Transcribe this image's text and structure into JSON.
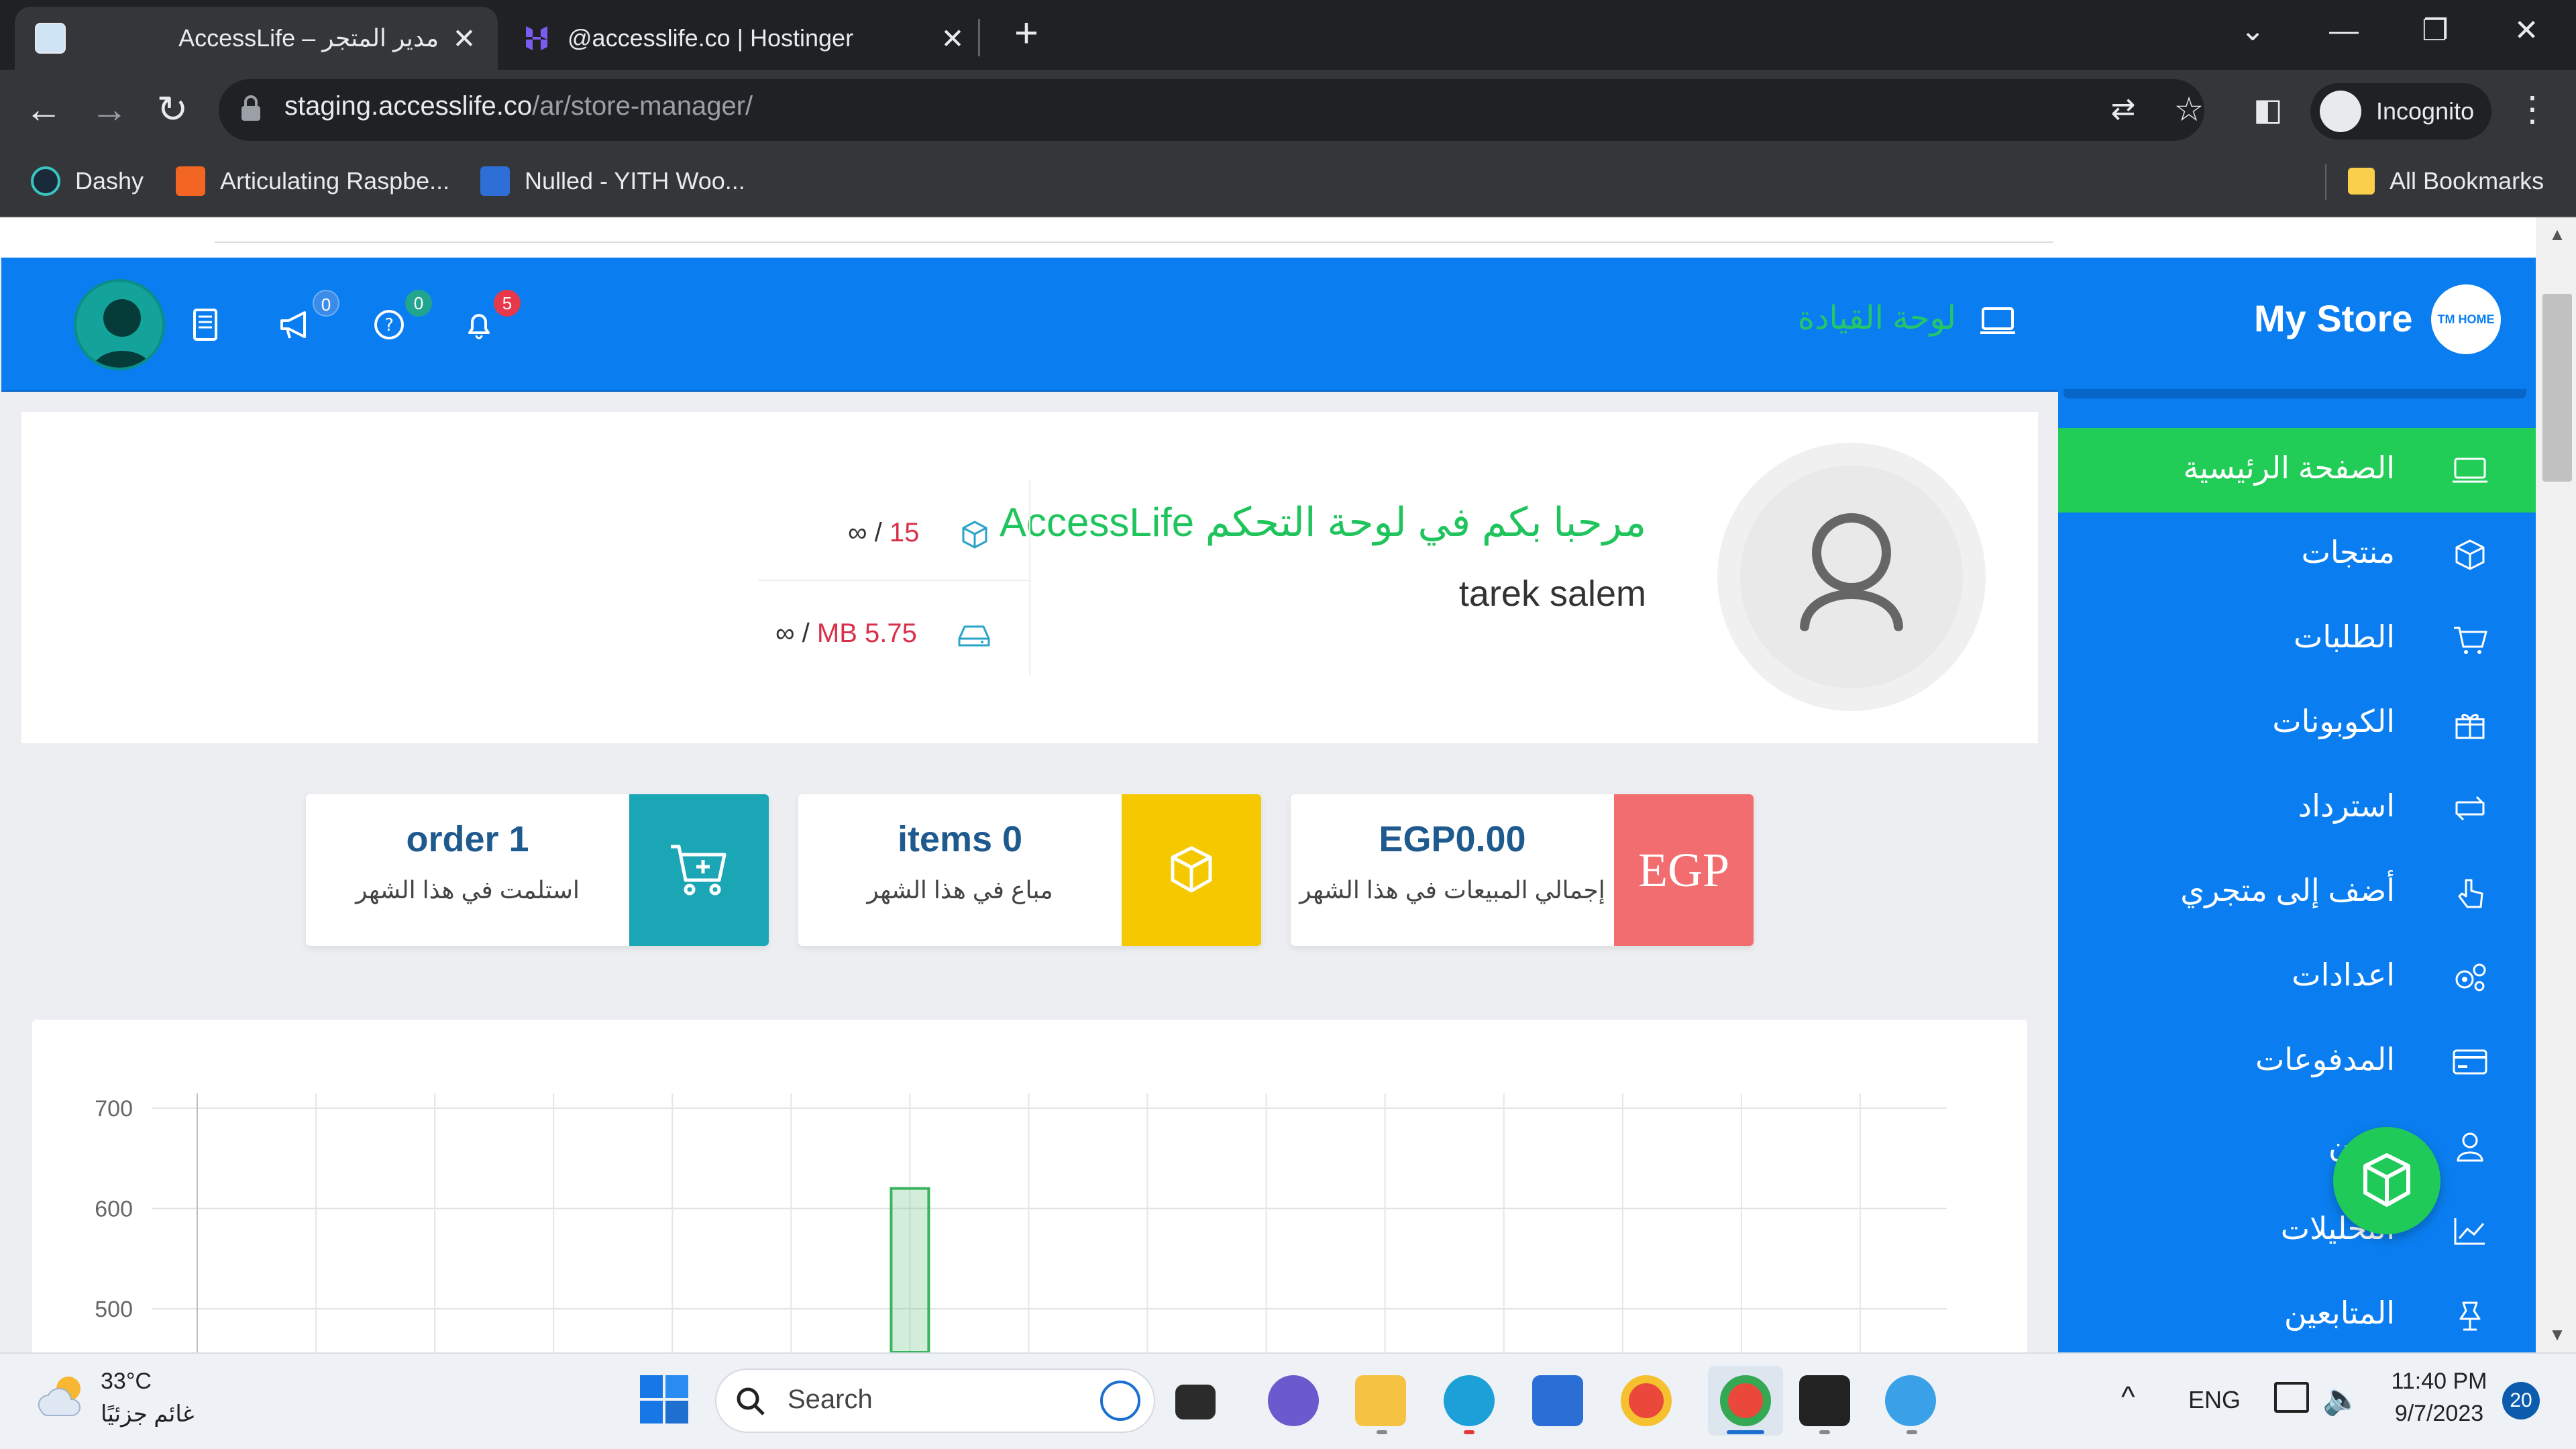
{
  "browser": {
    "tabs": [
      {
        "title": "AccessLife – مدير المتجر",
        "close": "✕"
      },
      {
        "title": "@accesslife.co | Hostinger",
        "close": "✕"
      }
    ],
    "new_tab": "+",
    "url_host": "staging.accesslife.co",
    "url_path": "/ar/store-manager/",
    "incognito_label": "Incognito",
    "bookmarks": [
      "Dashy",
      "Articulating Raspbe...",
      "Nulled - YITH Woo..."
    ],
    "all_bookmarks": "All Bookmarks"
  },
  "header": {
    "brand": "My Store",
    "brand_logo_text": "TM HOME",
    "dashboard_title": "لوحة القيادة",
    "badges": {
      "announcements": "0",
      "help": "0",
      "notifications": "5"
    }
  },
  "sidebar": {
    "items": [
      {
        "label": "الصفحة الرئيسية",
        "icon": "dashboard-icon",
        "active": true
      },
      {
        "label": "منتجات",
        "icon": "cube-icon"
      },
      {
        "label": "الطلبات",
        "icon": "cart-icon"
      },
      {
        "label": "الكوبونات",
        "icon": "gift-icon"
      },
      {
        "label": "استرداد",
        "icon": "refund-icon"
      },
      {
        "label": "أضف إلى متجري",
        "icon": "hand-pointer-icon"
      },
      {
        "label": "اعدادات",
        "icon": "cogs-icon"
      },
      {
        "label": "المدفوعات",
        "icon": "credit-card-icon"
      },
      {
        "label": "الفين",
        "icon": "user-icon"
      },
      {
        "label": "التحليلات",
        "icon": "chart-icon"
      },
      {
        "label": "المتابعين",
        "icon": "follower-icon"
      }
    ]
  },
  "welcome": {
    "message": "مرحبا بكم في لوحة التحكم AccessLife",
    "user": "tarek salem",
    "products_used": "15",
    "products_limit": "∞",
    "space_used": "MB 5.75",
    "space_limit": "∞",
    "sep": "/"
  },
  "stats": [
    {
      "value": "EGP0.00",
      "label": "إجمالي المبيعات في هذا الشهر",
      "icon_text": "EGP",
      "color": "#f26d6f"
    },
    {
      "value": "items 0",
      "label": "مباع في هذا الشهر",
      "icon": "cube-icon",
      "color": "#f5c800"
    },
    {
      "value": "order 1",
      "label": "استلمت في هذا الشهر",
      "icon": "cart-plus-icon",
      "color": "#1ba6b5"
    }
  ],
  "chart_data": {
    "type": "bar",
    "yticks": [
      "700",
      "600",
      "500"
    ],
    "ylim": [
      500,
      700
    ],
    "bars": [
      {
        "category_index": 6,
        "value": 620
      }
    ],
    "grid": true
  },
  "taskbar": {
    "temperature": "33°C",
    "weather": "غائم جزئيًا",
    "search": "Search",
    "lang": "ENG",
    "time": "11:40 PM",
    "date": "9/7/2023",
    "notifications": "20"
  }
}
